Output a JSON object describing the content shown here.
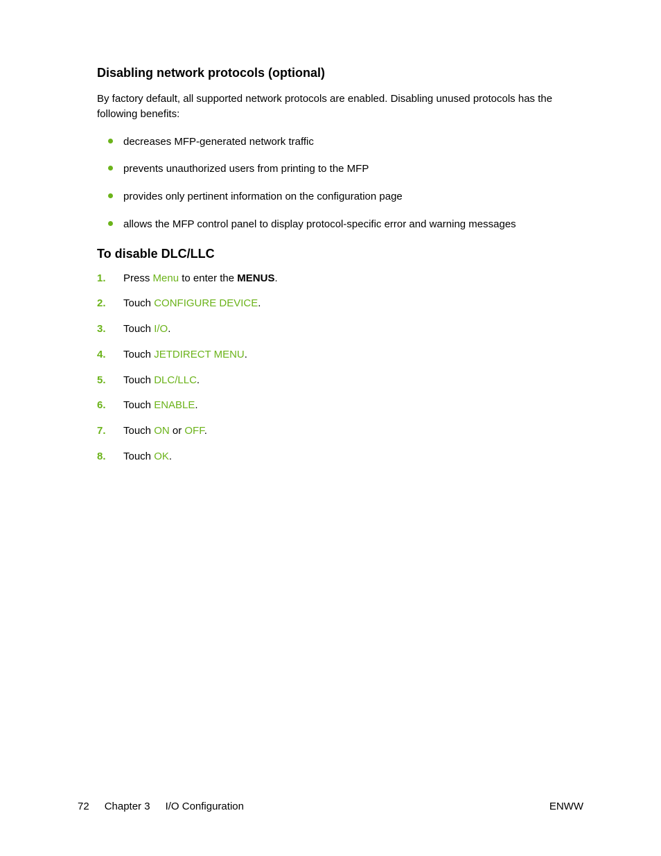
{
  "heading1": "Disabling network protocols (optional)",
  "intro": "By factory default, all supported network protocols are enabled. Disabling unused protocols has the following benefits:",
  "bullets": [
    "decreases MFP-generated network traffic",
    "prevents unauthorized users from printing to the MFP",
    "provides only pertinent information on the configuration page",
    "allows the MFP control panel to display protocol-specific error and warning messages"
  ],
  "heading2": "To disable DLC/LLC",
  "steps": [
    {
      "num": "1.",
      "pre": "Press ",
      "brand": "Menu",
      "mid": " to enter the ",
      "bold": "MENUS",
      "post": "."
    },
    {
      "num": "2.",
      "pre": "Touch ",
      "brand": "CONFIGURE DEVICE",
      "post": "."
    },
    {
      "num": "3.",
      "pre": "Touch ",
      "brand": "I/O",
      "post": "."
    },
    {
      "num": "4.",
      "pre": "Touch ",
      "brand": "JETDIRECT MENU",
      "post": "."
    },
    {
      "num": "5.",
      "pre": "Touch ",
      "brand": "DLC/LLC",
      "post": "."
    },
    {
      "num": "6.",
      "pre": "Touch ",
      "brand": "ENABLE",
      "post": "."
    },
    {
      "num": "7.",
      "pre": "Touch ",
      "brand": "ON",
      "mid": " or ",
      "brand2": "OFF",
      "post": "."
    },
    {
      "num": "8.",
      "pre": "Touch ",
      "brand": "OK",
      "post": "."
    }
  ],
  "footer": {
    "page": "72",
    "chapter": "Chapter 3",
    "title": "I/O Configuration",
    "right": "ENWW"
  }
}
